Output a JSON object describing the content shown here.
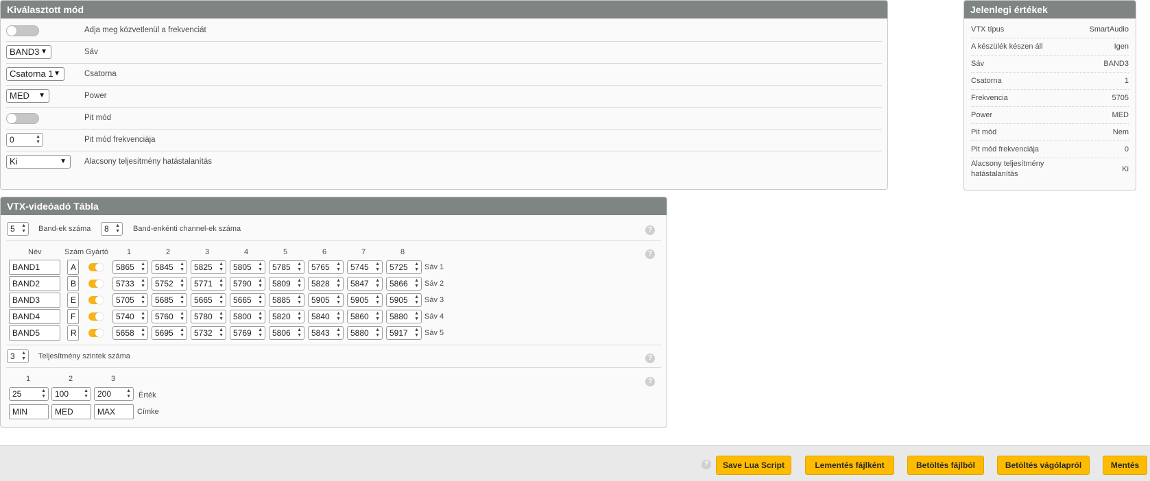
{
  "selected_mode": {
    "title": "Kiválasztott mód",
    "rows": [
      {
        "label": "Adja meg közvetlenül a frekvenciát",
        "control": "toggle",
        "value": "off"
      },
      {
        "label": "Sáv",
        "control": "select",
        "value": "BAND3"
      },
      {
        "label": "Csatorna",
        "control": "select",
        "value": "Csatorna 1"
      },
      {
        "label": "Power",
        "control": "select",
        "value": "MED"
      },
      {
        "label": "Pit mód",
        "control": "toggle",
        "value": "off"
      },
      {
        "label": "Pit mód frekvenciája",
        "control": "number",
        "value": "0"
      },
      {
        "label": "Alacsony teljesítmény hatástalanítás",
        "control": "select",
        "value": "Ki"
      }
    ]
  },
  "current_values": {
    "title": "Jelenlegi értékek",
    "rows": [
      {
        "key": "VTX típus",
        "value": "SmartAudio"
      },
      {
        "key": "A készülék készen áll",
        "value": "Igen"
      },
      {
        "key": "Sáv",
        "value": "BAND3"
      },
      {
        "key": "Csatorna",
        "value": "1"
      },
      {
        "key": "Frekvencia",
        "value": "5705"
      },
      {
        "key": "Power",
        "value": "MED"
      },
      {
        "key": "Pit mód",
        "value": "Nem"
      },
      {
        "key": "Pit mód frekvenciája",
        "value": "0"
      },
      {
        "key": "Alacsony teljesítmény",
        "key2": "hatástalanítás",
        "value": "Ki"
      }
    ]
  },
  "vtx_table": {
    "title": "VTX-videóadó Tábla",
    "band_count": "5",
    "band_count_label": "Band-ek száma",
    "channel_count": "8",
    "channel_count_label": "Band-enkénti channel-ek száma",
    "headers": {
      "name": "Név",
      "letter": "Szám",
      "factory": "Gyártó",
      "channels": [
        "1",
        "2",
        "3",
        "4",
        "5",
        "6",
        "7",
        "8"
      ]
    },
    "bands": [
      {
        "name": "BAND1",
        "letter": "A",
        "factory": true,
        "freqs": [
          "5865",
          "5845",
          "5825",
          "5805",
          "5785",
          "5765",
          "5745",
          "5725"
        ],
        "label": "Sáv 1"
      },
      {
        "name": "BAND2",
        "letter": "B",
        "factory": true,
        "freqs": [
          "5733",
          "5752",
          "5771",
          "5790",
          "5809",
          "5828",
          "5847",
          "5866"
        ],
        "label": "Sáv 2"
      },
      {
        "name": "BAND3",
        "letter": "E",
        "factory": true,
        "freqs": [
          "5705",
          "5685",
          "5665",
          "5665",
          "5885",
          "5905",
          "5905",
          "5905"
        ],
        "label": "Sáv 3"
      },
      {
        "name": "BAND4",
        "letter": "F",
        "factory": true,
        "freqs": [
          "5740",
          "5760",
          "5780",
          "5800",
          "5820",
          "5840",
          "5860",
          "5880"
        ],
        "label": "Sáv 4"
      },
      {
        "name": "BAND5",
        "letter": "R",
        "factory": true,
        "freqs": [
          "5658",
          "5695",
          "5732",
          "5769",
          "5806",
          "5843",
          "5880",
          "5917"
        ],
        "label": "Sáv 5"
      }
    ],
    "power_count": "3",
    "power_count_label": "Teljesítmény szintek száma",
    "power_headers": [
      "1",
      "2",
      "3"
    ],
    "power_values": [
      "25",
      "100",
      "200"
    ],
    "power_value_label": "Érték",
    "power_labels": [
      "MIN",
      "MED",
      "MAX"
    ],
    "power_label_label": "Címke"
  },
  "help_glyph": "?",
  "footer": {
    "buttons": [
      "Save Lua Script",
      "Lementés fájlként",
      "Betöltés fájlból",
      "Betöltés vágólapról",
      "Mentés"
    ]
  },
  "colors": {
    "accent": "#ffbb00",
    "header": "#7f8582",
    "toggle_on": "#f7b419"
  },
  "icons": {
    "help": "help-icon",
    "select": "chevron-down-icon",
    "spinner": "spinner-arrows-icon"
  }
}
